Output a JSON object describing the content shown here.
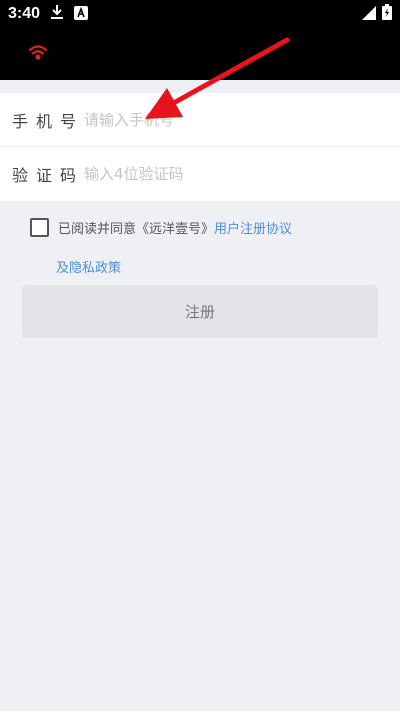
{
  "status_bar": {
    "time": "3:40",
    "download_icon": "download-icon",
    "notification_icon": "a-letter-icon",
    "signal_icon": "signal-icon",
    "battery_icon": "battery-charging-icon"
  },
  "toolbar": {
    "logo_icon": "wifi-icon",
    "logo_color": "#e02020"
  },
  "form": {
    "phone_label": "手机号",
    "phone_placeholder": "请输入手机号",
    "code_label": "验证码",
    "code_placeholder": "输入4位验证码"
  },
  "agreement": {
    "prefix": "已阅读并同意《远洋壹号》",
    "user_agreement": "用户注册协议",
    "privacy_policy": "及隐私政策"
  },
  "register_button": {
    "label": "注册"
  },
  "annotation": {
    "arrow_color": "#e8141c",
    "arrow_icon": "red-arrow-icon"
  }
}
